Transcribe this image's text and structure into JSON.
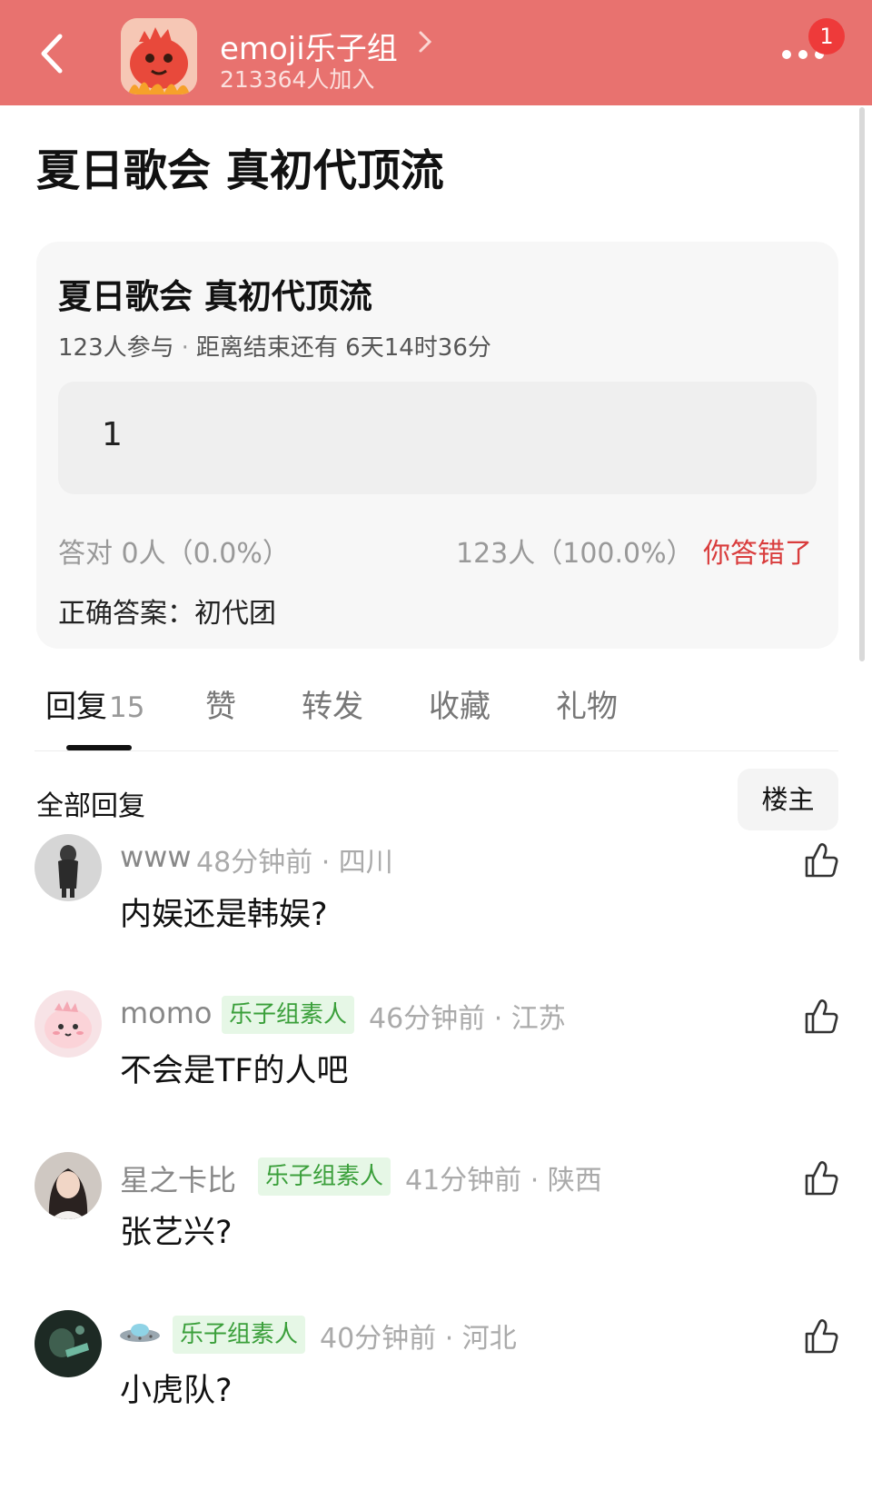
{
  "header": {
    "group_name": "emoji乐子组",
    "members": "213364人加入",
    "notification_count": "1",
    "accent_color": "#e8726f"
  },
  "post": {
    "title": "夏日歌会 真初代顶流"
  },
  "quiz": {
    "title": "夏日歌会 真初代顶流",
    "participants": "123人参与",
    "countdown": "距离结束还有 6天14时36分",
    "my_answer": "1",
    "correct_label": "答对",
    "correct_stat": "0人（0.0%）",
    "wrong_stat": "123人（100.0%）",
    "wrong_tag": "你答错了",
    "correct_answer": "正确答案：初代团"
  },
  "tabs": [
    {
      "label": "回复",
      "count": "15",
      "active": true
    },
    {
      "label": "赞"
    },
    {
      "label": "转发"
    },
    {
      "label": "收藏"
    },
    {
      "label": "礼物"
    }
  ],
  "replies_header": {
    "title": "全部回复",
    "filter_button": "楼主"
  },
  "comments": [
    {
      "name": "www",
      "tag": "",
      "time": "48分钟前 · 四川",
      "text": "内娱还是韩娱?",
      "avatar_icon": "user-photo-avatar"
    },
    {
      "name": "momo",
      "tag": "乐子组素人",
      "time": "46分钟前 · 江苏",
      "text": "不会是TF的人吧",
      "avatar_icon": "pink-dinosaur-avatar"
    },
    {
      "name": "星之卡比",
      "tag": "乐子组素人",
      "time": "41分钟前 · 陕西",
      "text": "张艺兴?",
      "avatar_icon": "user-photo-avatar"
    },
    {
      "name": "",
      "tag": "乐子组素人",
      "time": "40分钟前 · 河北",
      "text": "小虎队?",
      "avatar_icon": "ufo-emoji-name"
    }
  ]
}
